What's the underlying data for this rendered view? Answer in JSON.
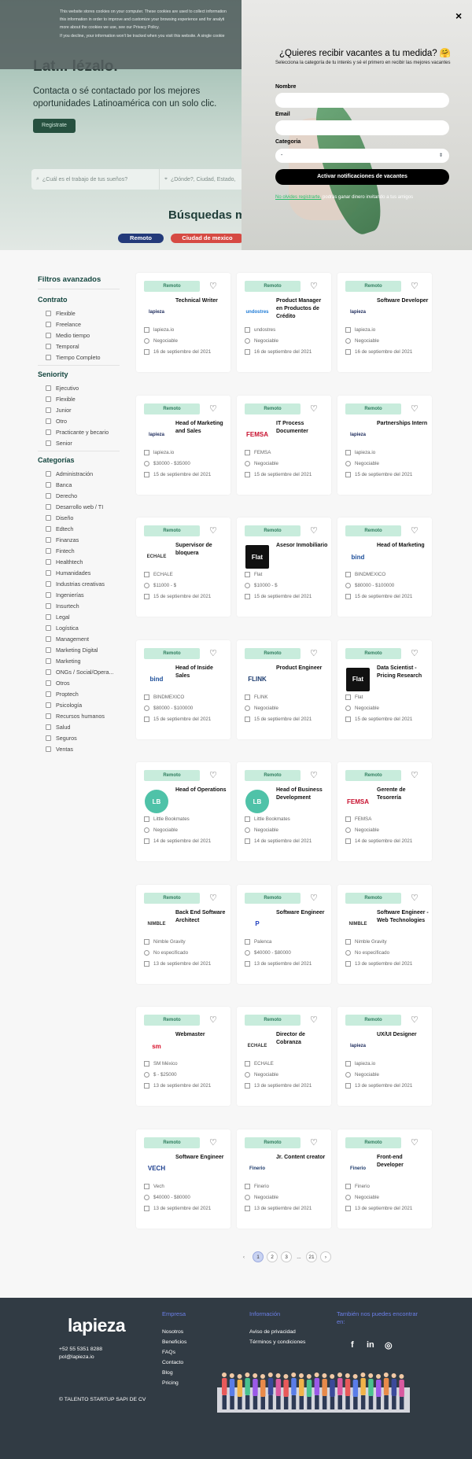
{
  "hero": {
    "title_fragment": "Lat... lézalo.",
    "subtitle": "Contacta o sé contactado por los mejores oportunidades Latinoamérica con un solo clic.",
    "register_button": "Registrate",
    "search_placeholder": "¿Cuál es el trabajo de tus sueños?",
    "location_placeholder": "¿Dónde?, Ciudad, Estado,",
    "searches_title": "Búsquedas má",
    "popular": [
      "Remoto",
      "Ciudad de mexico"
    ]
  },
  "cookie_banner": {
    "lines": [
      "This website stores cookies on your computer. These cookies are used to collect information",
      "this information in order to improve and customize your browsing experience and for analyti",
      "more about the cookies we use, see our Privacy Policy.",
      "If you decline, your information won't be tracked when you visit this website. A single cookie"
    ]
  },
  "modal": {
    "close": "×",
    "title": "¿Quieres recibir  vacantes a tu medida? 🤗",
    "subtitle": "Selecciona la categoría de tu interés y sé el primero en recibir las mejores vacantes",
    "name_label": "Nombre",
    "email_label": "Email",
    "category_label": "Categoria",
    "category_value": "-",
    "submit": "Activar notificaciones de vacantes",
    "note_link": "No olvides registrarte,",
    "note_text": " podrás ganar dinero invitando a tus amigos"
  },
  "filters": {
    "title": "Filtros avanzados",
    "contrato_title": "Contrato",
    "contrato": [
      "Flexible",
      "Freelance",
      "Medio tiempo",
      "Temporal",
      "Tiempo Completo"
    ],
    "seniority_title": "Seniority",
    "seniority": [
      "Ejecutivo",
      "Flexible",
      "Junior",
      "Otro",
      "Practicante y becario",
      "Senior"
    ],
    "categorias_title": "Categorías",
    "categorias": [
      "Administración",
      "Banca",
      "Derecho",
      "Desarrollo web / TI",
      "Diseño",
      "Edtech",
      "Finanzas",
      "Fintech",
      "Healthtech",
      "Humanidades",
      "Industrias creativas",
      "Ingenierías",
      "Insurtech",
      "Legal",
      "Logística",
      "Management",
      "Marketing Digital",
      "Marketing",
      "ONGs / Social/Opera...",
      "Otros",
      "Proptech",
      "Psicología",
      "Recursos humanos",
      "Salud",
      "Seguros",
      "Ventas"
    ]
  },
  "jobs": [
    {
      "badge": "Remoto",
      "title": "Technical Writer",
      "company": "lapieza.io",
      "salary": "Negociable",
      "date": "16 de septiembre del 2021",
      "logo": "lapieza",
      "logo_bg": "#ffffff",
      "logo_fg": "#1d2b5c"
    },
    {
      "badge": "Remoto",
      "title": "Product Manager en Productos de Crédito",
      "company": "undostres",
      "salary": "Negociable",
      "date": "16 de septiembre del 2021",
      "logo": "undostres",
      "logo_bg": "#ffffff",
      "logo_fg": "#1e7bd6"
    },
    {
      "badge": "Remoto",
      "title": "Software Developer",
      "company": "lapieza.io",
      "salary": "Negociable",
      "date": "16 de septiembre del 2021",
      "logo": "lapieza",
      "logo_bg": "#ffffff",
      "logo_fg": "#1d2b5c"
    },
    {
      "badge": "Remoto",
      "title": "Head of Marketing and Sales",
      "company": "lapieza.io",
      "salary": "$30000 - $35000",
      "date": "15 de septiembre del 2021",
      "logo": "lapieza",
      "logo_bg": "#ffffff",
      "logo_fg": "#1d2b5c"
    },
    {
      "badge": "Remoto",
      "title": "IT Process Documenter",
      "company": "FEMSA",
      "salary": "Negociable",
      "date": "15 de septiembre del 2021",
      "logo": "FEMSA",
      "logo_bg": "#ffffff",
      "logo_fg": "#c8102e"
    },
    {
      "badge": "Remoto",
      "title": "Partnerships Intern",
      "company": "lapieza.io",
      "salary": "Negociable",
      "date": "15 de septiembre del 2021",
      "logo": "lapieza",
      "logo_bg": "#ffffff",
      "logo_fg": "#1d2b5c"
    },
    {
      "badge": "Remoto",
      "title": "Supervisor de bloquera",
      "company": "ECHALE",
      "salary": "$11000 - $",
      "date": "15 de septiembre del 2021",
      "logo": "ECHALE",
      "logo_bg": "#ffffff",
      "logo_fg": "#333333"
    },
    {
      "badge": "Remoto",
      "title": "Asesor Inmobiliario",
      "company": "Flat",
      "salary": "$10000 - $",
      "date": "15 de septiembre del 2021",
      "logo": "Flat",
      "logo_bg": "#111111",
      "logo_fg": "#ffffff"
    },
    {
      "badge": "Remoto",
      "title": "Head of Marketing",
      "company": "BINDMEXICO",
      "salary": "$80000 - $100000",
      "date": "15 de septiembre del 2021",
      "logo": "bind",
      "logo_bg": "#ffffff",
      "logo_fg": "#1c4e9a"
    },
    {
      "badge": "Remoto",
      "title": "Head of Inside Sales",
      "company": "BINDMEXICO",
      "salary": "$80000 - $100000",
      "date": "15 de septiembre del 2021",
      "logo": "bind",
      "logo_bg": "#ffffff",
      "logo_fg": "#1c4e9a"
    },
    {
      "badge": "Remoto",
      "title": "Product Engineer",
      "company": "FLINK",
      "salary": "Negociable",
      "date": "15 de septiembre del 2021",
      "logo": "FLINK",
      "logo_bg": "#ffffff",
      "logo_fg": "#1b3b6f"
    },
    {
      "badge": "Remoto",
      "title": "Data Scientist - Pricing Research",
      "company": "Flat",
      "salary": "Negociable",
      "date": "15 de septiembre del 2021",
      "logo": "Flat",
      "logo_bg": "#111111",
      "logo_fg": "#ffffff"
    },
    {
      "badge": "Remoto",
      "title": "Head of Operations",
      "company": "Little Bookmates",
      "salary": "Negociable",
      "date": "14 de septiembre del 2021",
      "logo": "LB",
      "logo_bg": "#4fc2a8",
      "logo_fg": "#ffffff"
    },
    {
      "badge": "Remoto",
      "title": "Head of Business Development",
      "company": "Little Bookmates",
      "salary": "Negociable",
      "date": "14 de septiembre del 2021",
      "logo": "LB",
      "logo_bg": "#4fc2a8",
      "logo_fg": "#ffffff"
    },
    {
      "badge": "Remoto",
      "title": "Gerente de Tesorería",
      "company": "FEMSA",
      "salary": "Negociable",
      "date": "14 de septiembre del 2021",
      "logo": "FEMSA",
      "logo_bg": "#ffffff",
      "logo_fg": "#c8102e"
    },
    {
      "badge": "Remoto",
      "title": "Back End Software Architect",
      "company": "Nimble Gravity",
      "salary": "No especificado",
      "date": "13 de septiembre del 2021",
      "logo": "NIMBLE",
      "logo_bg": "#ffffff",
      "logo_fg": "#333333"
    },
    {
      "badge": "Remoto",
      "title": "Software Engineer",
      "company": "Palenca",
      "salary": "$40000 - $80000",
      "date": "13 de septiembre del 2021",
      "logo": "P",
      "logo_bg": "#ffffff",
      "logo_fg": "#1f3fbf"
    },
    {
      "badge": "Remoto",
      "title": "Software Engineer - Web Technologies",
      "company": "Nimble Gravity",
      "salary": "No especificado",
      "date": "13 de septiembre del 2021",
      "logo": "NIMBLE",
      "logo_bg": "#ffffff",
      "logo_fg": "#333333"
    },
    {
      "badge": "Remoto",
      "title": "Webmaster",
      "company": "SM México",
      "salary": "$ - $25000",
      "date": "13 de septiembre del 2021",
      "logo": "sm",
      "logo_bg": "#ffffff",
      "logo_fg": "#d8102a"
    },
    {
      "badge": "Remoto",
      "title": "Director de Cobranza",
      "company": "ECHALE",
      "salary": "Negociable",
      "date": "13 de septiembre del 2021",
      "logo": "ECHALE",
      "logo_bg": "#ffffff",
      "logo_fg": "#333333"
    },
    {
      "badge": "Remoto",
      "title": "UX/UI Designer",
      "company": "lapieza.io",
      "salary": "Negociable",
      "date": "13 de septiembre del 2021",
      "logo": "lapieza",
      "logo_bg": "#ffffff",
      "logo_fg": "#1d2b5c"
    },
    {
      "badge": "Remoto",
      "title": "Software Engineer",
      "company": "Vech",
      "salary": "$40000 - $80000",
      "date": "13 de septiembre del 2021",
      "logo": "VECH",
      "logo_bg": "#ffffff",
      "logo_fg": "#1d3f8f"
    },
    {
      "badge": "Remoto",
      "title": "Jr. Content creator",
      "company": "Finerio",
      "salary": "Negociable",
      "date": "13 de septiembre del 2021",
      "logo": "Finerio",
      "logo_bg": "#ffffff",
      "logo_fg": "#1d3a6b"
    },
    {
      "badge": "Remoto",
      "title": "Front-end Developer",
      "company": "Finerio",
      "salary": "Negociable",
      "date": "13 de septiembre del 2021",
      "logo": "Finerio",
      "logo_bg": "#ffffff",
      "logo_fg": "#1d3a6b"
    }
  ],
  "pagination": {
    "prev": "‹",
    "pages": [
      "1",
      "2",
      "3"
    ],
    "dots": "...",
    "last": "21",
    "next": "›"
  },
  "footer": {
    "logo": "lapieza",
    "phone": "+52 55 5351 8288",
    "email": "pol@lapieza.io",
    "copyright": "© TALENTO STARTUP SAPI DE CV",
    "empresa_title": "Empresa",
    "empresa": [
      "Nosotros",
      "Beneficios",
      "FAQs",
      "Contacto",
      "Blog",
      "Pricing"
    ],
    "info_title": "Información",
    "info": [
      "Aviso de privacidad",
      "Términos y condiciones"
    ],
    "social_title": "También nos puedes encontrar en:",
    "social": [
      "f",
      "in",
      "◎"
    ]
  }
}
